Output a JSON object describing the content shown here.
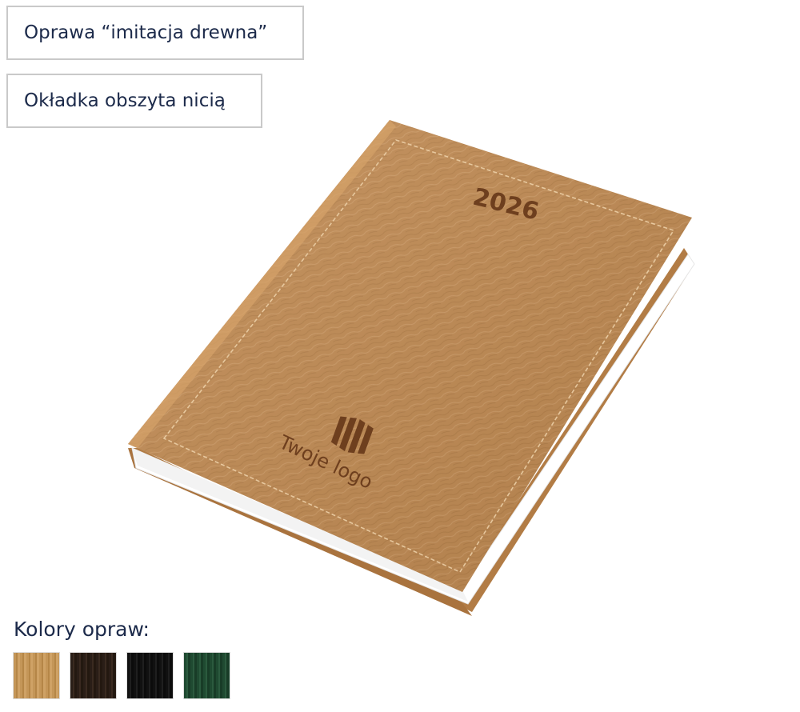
{
  "badges": {
    "binding": "Oprawa “imitacja drewna”",
    "stitching": "Okładka obszyta nicią"
  },
  "product": {
    "year": "2026",
    "logo_text": "Twoje logo",
    "cover_color": "#c08a52"
  },
  "colors_section": {
    "title": "Kolory opraw:",
    "swatches": [
      {
        "name": "wood",
        "color": "#c49658"
      },
      {
        "name": "dark-brown",
        "color": "#2a1e17"
      },
      {
        "name": "black",
        "color": "#111111"
      },
      {
        "name": "dark-green",
        "color": "#1f4a31"
      }
    ]
  }
}
